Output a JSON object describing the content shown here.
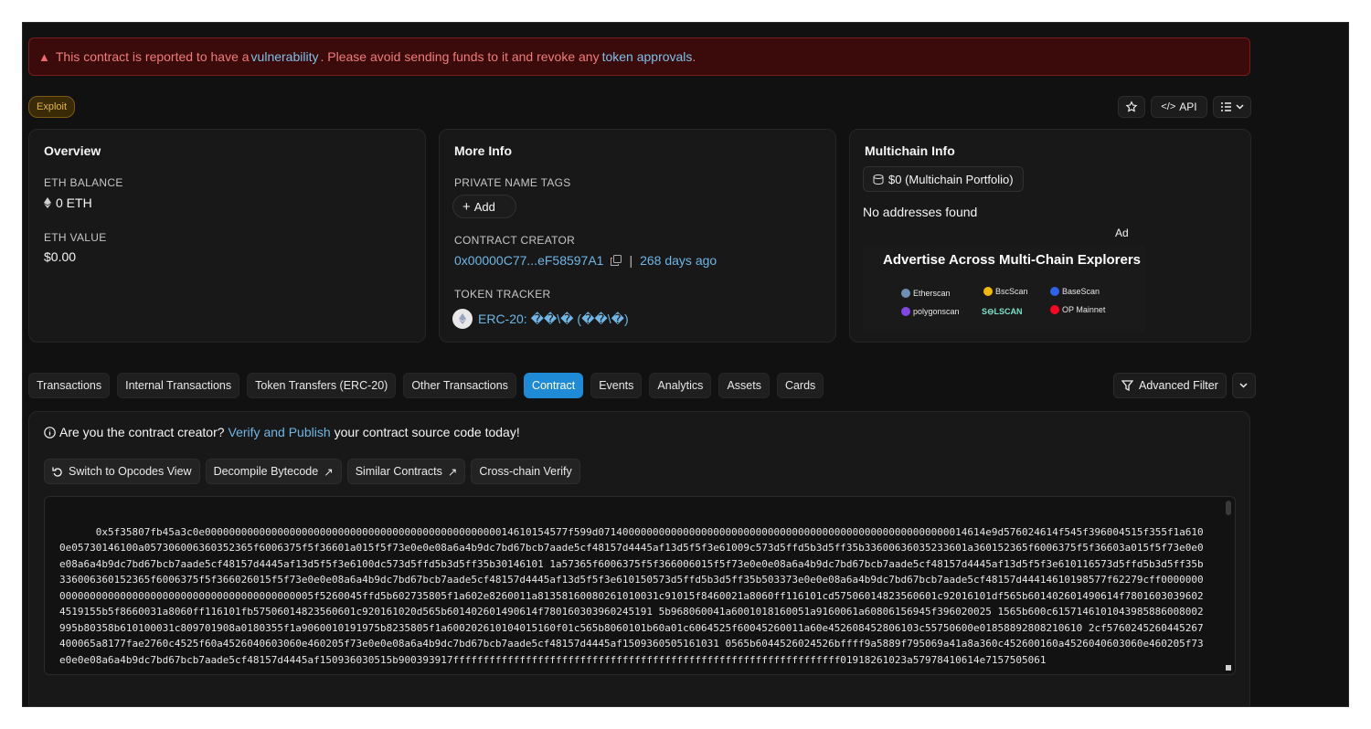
{
  "alert": {
    "prefix": "This contract is reported to have a ",
    "link1": "vulnerability",
    "middle": ". Please avoid sending funds to it and revoke any ",
    "link2": "token approvals",
    "suffix": "."
  },
  "badge": "Exploit",
  "toolbar": {
    "api_label": "API"
  },
  "overview": {
    "title": "Overview",
    "eth_balance_label": "ETH BALANCE",
    "eth_balance": "0 ETH",
    "eth_value_label": "ETH VALUE",
    "eth_value": "$0.00"
  },
  "more_info": {
    "title": "More Info",
    "private_tags_label": "PRIVATE NAME TAGS",
    "add_label": "Add",
    "creator_label": "CONTRACT CREATOR",
    "creator_address": "0x00000C77...eF58597A1",
    "separator": "|",
    "creator_age": "268 days ago",
    "token_tracker_label": "TOKEN TRACKER",
    "token_tracker": "ERC-20: ��\\� (��\\�)"
  },
  "multichain": {
    "title": "Multichain Info",
    "portfolio": "$0 (Multichain Portfolio)",
    "no_addresses": "No addresses found",
    "ad_label": "Ad",
    "ad_headline": "Advertise Across Multi-Chain Explorers",
    "ad_logos": [
      "Etherscan",
      "BscScan",
      "BaseScan",
      "polygonscan",
      "S⊖LSCAN",
      "OP Mainnet"
    ]
  },
  "tabs": [
    "Transactions",
    "Internal Transactions",
    "Token Transfers (ERC-20)",
    "Other Transactions",
    "Contract",
    "Events",
    "Analytics",
    "Assets",
    "Cards"
  ],
  "active_tab": "Contract",
  "advanced_filter": "Advanced Filter",
  "contract": {
    "verify_prefix": "Are you the contract creator? ",
    "verify_link": "Verify and Publish",
    "verify_suffix": " your contract source code today!",
    "buttons": [
      "Switch to Opcodes View",
      "Decompile Bytecode",
      "Similar Contracts",
      "Cross-chain Verify"
    ],
    "bytecode": "0x5f35807fb45a3c0e000000000000000000000000000000000000000000000000014610154577f599d0714000000000000000000000000000000000000000000000000000000014614e9d576024614f545f396004515f355f1a6100e05730146100a057306006360352365f6006375f5f36601a015f5f73e0e0e08a6a4b9dc7bd67bcb7aade5cf48157d4445af13d5f5f3e61009c573d5ffd5b3d5ff35b33600636035233601a360152365f6006375f5f36603a015f5f73e0e0e08a6a4b9dc7bd67bcb7aade5cf48157d4445af13d5f5f3e6100dc573d5ffd5b3d5ff35b30146101 1a57365f6006375f5f366006015f5f73e0e0e08a6a4b9dc7bd67bcb7aade5cf48157d4445af13d5f5f3e610116573d5ffd5b3d5ff35b336006360152365f6006375f5f366026015f5f73e0e0e08a6a4b9dc7bd67bcb7aade5cf48157d4445af13d5f5f3e610150573d5ffd5b3d5ff35b503373e0e0e08a6a4b9dc7bd67bcb7aade5cf48157d44414610198577f62279cff0000000000000000000000000000000000000000000000005f5260045ffd5b602735805f1a602e8260011a81358160080261010031c91015f8460021a8060ff116101cd57506014823560601c92016101df565b601402601490614f78016030396024519155b5f8660031a8060ff116101fb57506014823560601c920161020d565b601402601490614f780160303960245191 5b968060041a6001018160051a9160061a60806156945f396020025 1565b600c6157146101043985886008002995b80358b610100031c809701908a0180355f1a9060010191975b8235805f1a600202610104015160f01c565b8060101b60a01c6064525f60045260011a60e452608452806103c55750600e01858892808210610 2cf5760245260445267400065a8177fae2760c4525f60a4526040603060e460205f73e0e0e08a6a4b9dc7bd67bcb7aade5cf48157d4445af1509360505161031 0565b6044526024526bffff9a5889f795069a41a8a360c452600160a4526040603060e460205f73e0e0e08a6a4b9dc7bd67bcb7aade5cf48157d4445af150936030515b900393917ffffffffffffffffffffffffffffffffffffffffffffffffffffffffffffffff01918261023a57978410614e7157505061"
  },
  "colors": {
    "accent": "#1f8ad6",
    "link": "#6fb6e6",
    "danger": "#ef7b7b",
    "badge": "#e0b43c"
  }
}
